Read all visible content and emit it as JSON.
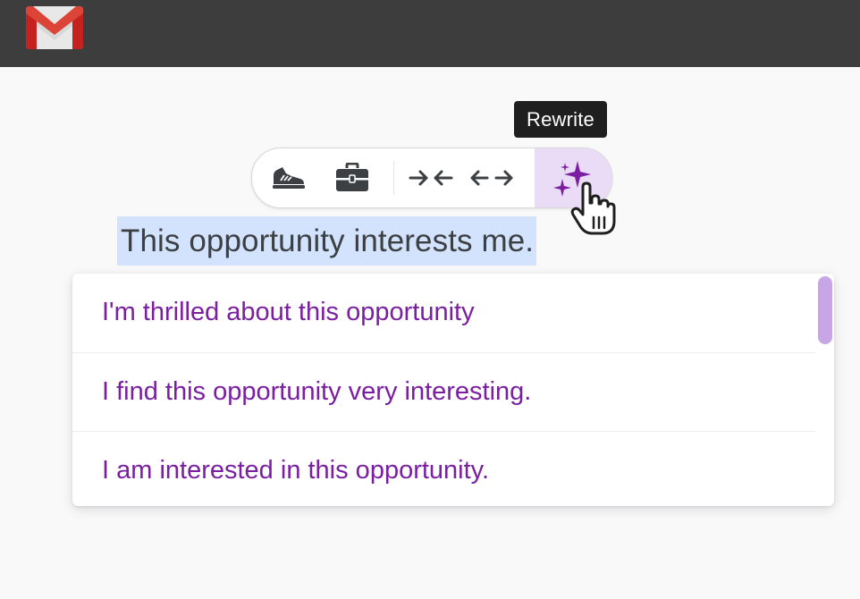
{
  "app": {
    "logo_icon": "gmail-logo"
  },
  "tooltip": {
    "text": "Rewrite"
  },
  "toolbar": {
    "buttons": [
      {
        "name": "formalize",
        "icon": "sneaker-icon"
      },
      {
        "name": "formalize-business",
        "icon": "briefcase-icon"
      },
      {
        "name": "shorten",
        "icon": "arrows-inward-icon"
      },
      {
        "name": "elaborate",
        "icon": "arrows-outward-icon"
      },
      {
        "name": "rewrite",
        "icon": "sparkle-icon",
        "active": true
      }
    ],
    "active_color": "#eadcf7",
    "sparkle_color": "#7b1fa2"
  },
  "editor": {
    "selected_text": "This opportunity interests me.",
    "selection_color": "#d3e3fd"
  },
  "suggestions": {
    "items": [
      "I'm thrilled about this opportunity",
      "I find this opportunity very interesting.",
      "I am interested in this opportunity."
    ],
    "text_color": "#7b1fa2",
    "scrollbar_color": "#c8a6e6"
  },
  "cursor": {
    "icon": "hand-pointer-icon"
  }
}
